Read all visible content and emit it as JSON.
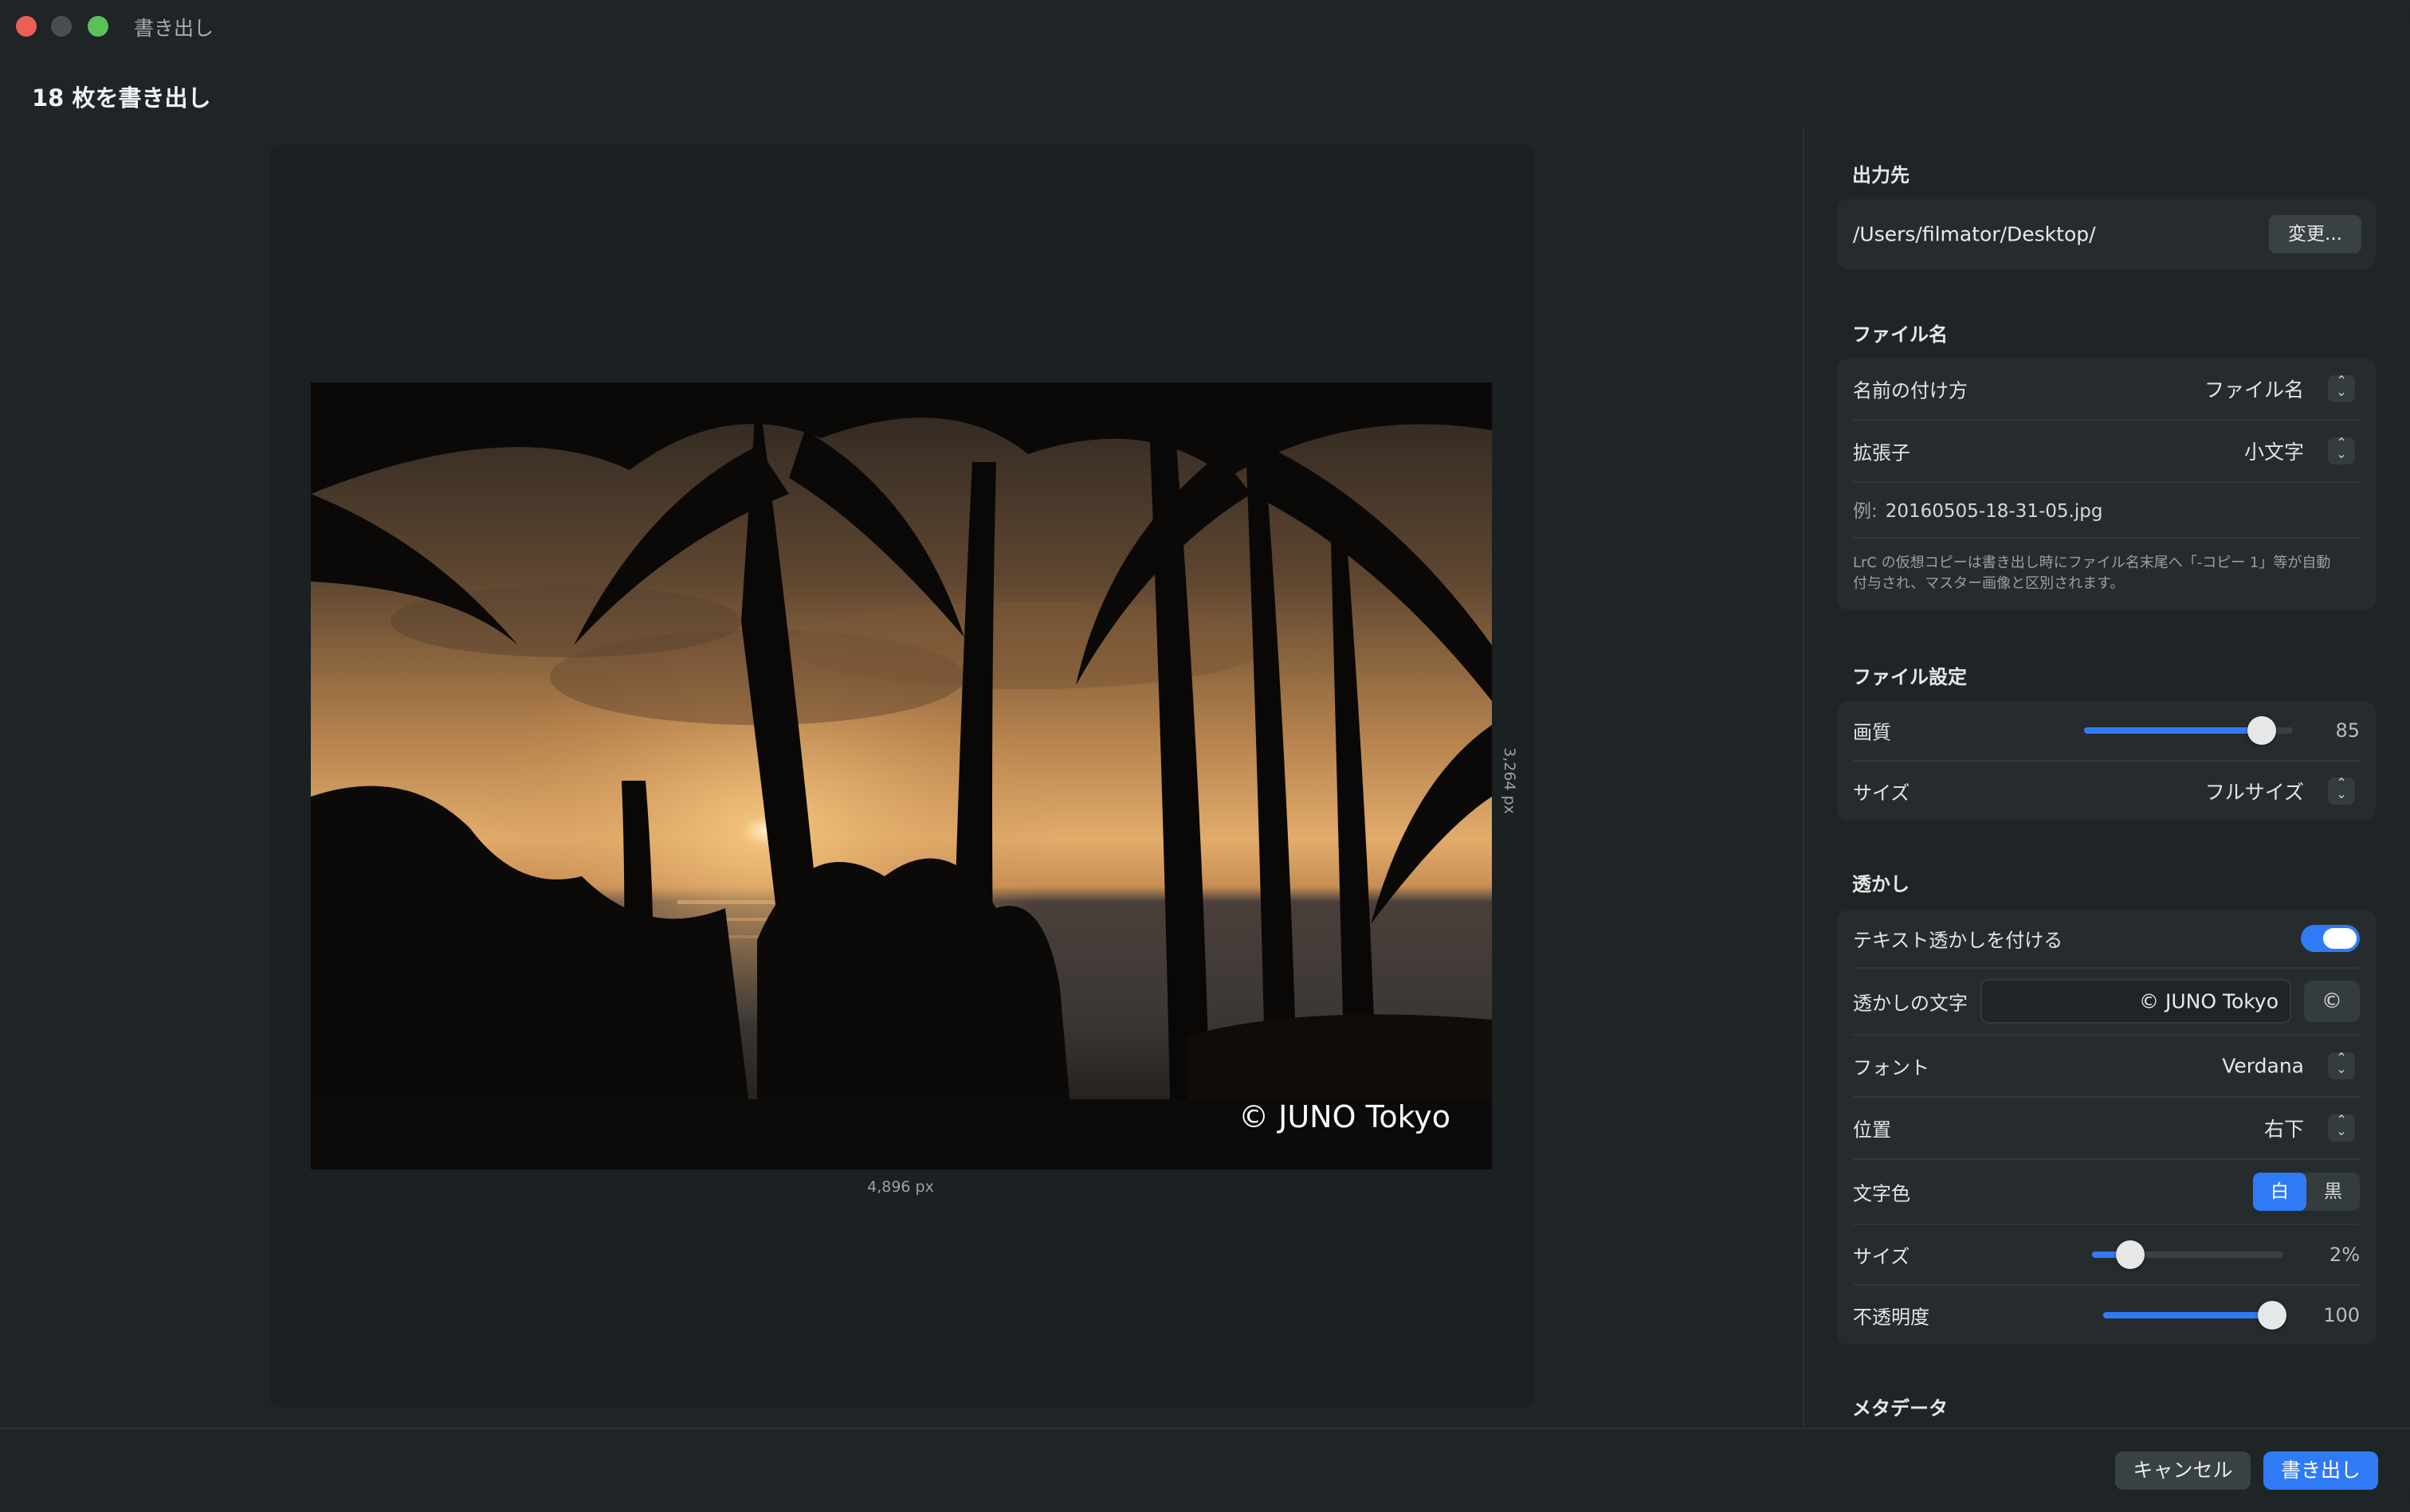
{
  "window": {
    "title": "書き出し"
  },
  "heading": "18 枚を書き出し",
  "preview": {
    "watermark": "© JUNO Tokyo",
    "width_label": "4,896 px",
    "height_label": "3,264 px"
  },
  "destination": {
    "title": "出力先",
    "path": "/Users/filmator/Desktop/",
    "change_label": "変更..."
  },
  "filename": {
    "title": "ファイル名",
    "naming_label": "名前の付け方",
    "naming_value": "ファイル名",
    "extension_label": "拡張子",
    "extension_value": "小文字",
    "example_prefix": "例:",
    "example_value": "20160505-18-31-05.jpg",
    "note": "LrC の仮想コピーは書き出し時にファイル名末尾へ「-コピー 1」等が自動付与され、マスター画像と区別されます。"
  },
  "file_settings": {
    "title": "ファイル設定",
    "quality_label": "画質",
    "quality_value": 85,
    "quality_display": "85",
    "size_label": "サイズ",
    "size_value": "フルサイズ"
  },
  "watermark": {
    "title": "透かし",
    "enable_label": "テキスト透かしを付ける",
    "enabled": true,
    "text_label": "透かしの文字",
    "text_value": "© JUNO Tokyo",
    "copyright_symbol": "©",
    "font_label": "フォント",
    "font_value": "Verdana",
    "position_label": "位置",
    "position_value": "右下",
    "color_label": "文字色",
    "color_white": "白",
    "color_black": "黒",
    "selected_color": "白",
    "size_label": "サイズ",
    "size_value": 2,
    "size_display": "2%",
    "opacity_label": "不透明度",
    "opacity_value": 100,
    "opacity_display": "100"
  },
  "metadata": {
    "title": "メタデータ"
  },
  "footer": {
    "cancel_label": "キャンセル",
    "export_label": "書き出し"
  },
  "colors": {
    "accent": "#2f7bf5",
    "background": "#1f2527",
    "card": "#262c2e"
  }
}
